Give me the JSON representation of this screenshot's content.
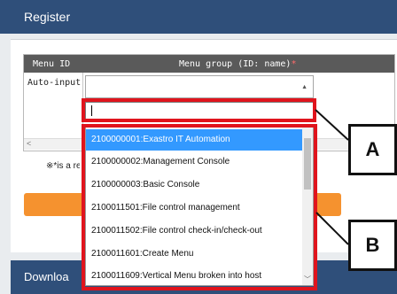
{
  "register": {
    "title": "Register"
  },
  "table": {
    "col_menu_id": "Menu ID",
    "col_menu_group": "Menu group (ID: name)",
    "required_mark": "*",
    "auto_input": "Auto-input"
  },
  "note": {
    "text": "※*is a re"
  },
  "download": {
    "title": "Downloa"
  },
  "dropdown": {
    "options": [
      "2100000001:Exastro IT Automation",
      "2100000002:Management Console",
      "2100000003:Basic Console",
      "2100011501:File control management",
      "2100011502:File control check-in/check-out",
      "2100011601:Create Menu",
      "2100011609:Vertical Menu broken into host"
    ]
  },
  "callouts": {
    "a": "A",
    "b": "B"
  },
  "colors": {
    "header": "#2f4f7a",
    "selection": "#3399ff",
    "callout": "#e0141d",
    "button": "#f5922f"
  },
  "icons": [
    "select-arrow-icon",
    "scroll-left-icon",
    "scroll-down-icon"
  ]
}
